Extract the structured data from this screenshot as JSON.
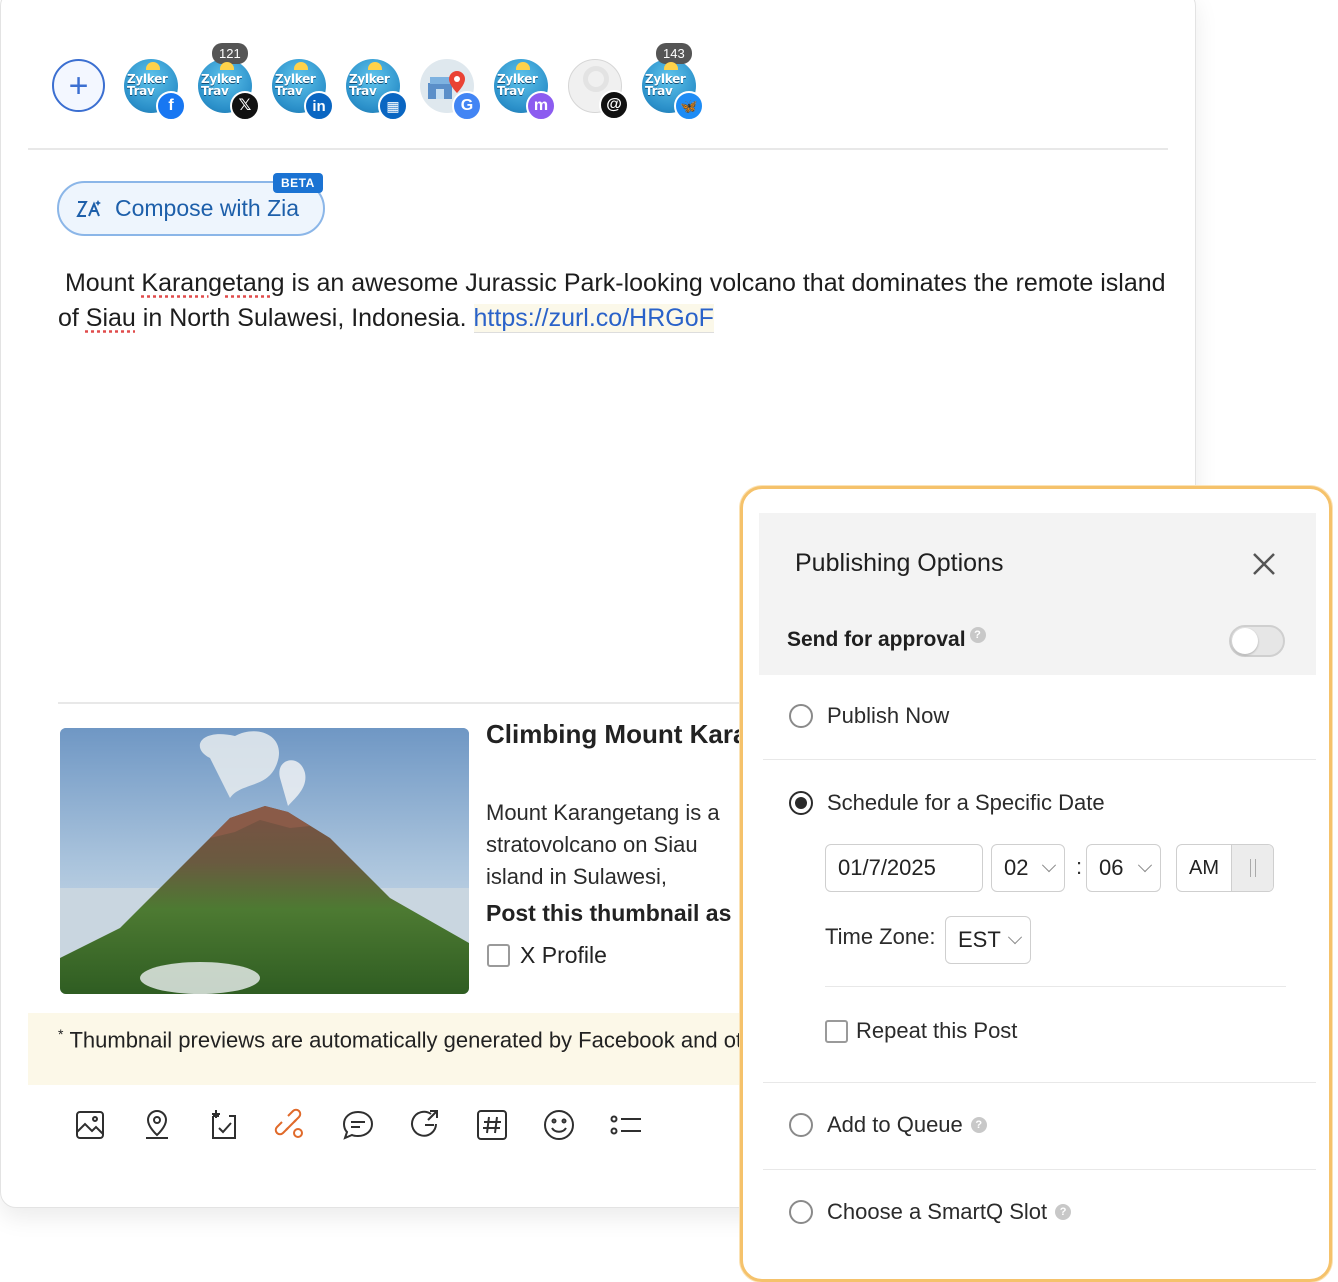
{
  "profiles": {
    "add_label": "+",
    "avatar_text": "Zylker Trav",
    "accounts": [
      {
        "network": "facebook",
        "badge": "",
        "color": "#1877f2",
        "glyph": "f"
      },
      {
        "network": "x",
        "badge": "121",
        "color": "#111111",
        "glyph": "𝕏"
      },
      {
        "network": "linkedin",
        "badge": "",
        "color": "#0a66c2",
        "glyph": "in"
      },
      {
        "network": "linkedin-page",
        "badge": "",
        "color": "#0a66c2",
        "glyph": "▦"
      },
      {
        "network": "google-business",
        "badge": "",
        "color": "#4285f4",
        "glyph": "G"
      },
      {
        "network": "mastodon",
        "badge": "",
        "color": "#8c5cf0",
        "glyph": "m"
      },
      {
        "network": "threads",
        "badge": "",
        "color": "#111111",
        "glyph": "@"
      },
      {
        "network": "bluesky",
        "badge": "143",
        "color": "#1e8cf5",
        "glyph": "🦋"
      }
    ]
  },
  "zia": {
    "label": "Compose with Zia",
    "badge": "BETA"
  },
  "post": {
    "text_1": "Mount ",
    "text_2": "Karangetang",
    "text_3": " is an awesome Jurassic Park-looking volcano that dominates the remote island of ",
    "text_4": "Siau",
    "text_5": " in North Sulawesi, Indonesia.  ",
    "link": "https://zurl.co/HRGoF"
  },
  "preview": {
    "title": "Climbing Mount Karangetang in Sulawesi",
    "description": "Mount Karangetang is a stratovolcano on Siau island in Sulawesi, Indonesia. Climb the mountain!",
    "post_thumbnail_label": "Post this thumbnail as image",
    "x_profile_label": "X Profile"
  },
  "note": {
    "marker": "*",
    "text": "Thumbnail previews are automatically generated by Facebook and other networks"
  },
  "toolbar": [
    "image-icon",
    "location-icon",
    "schedule-post-icon",
    "link-settings-icon",
    "comment-icon",
    "repost-icon",
    "hashtag-icon",
    "emoji-icon",
    "list-icon"
  ],
  "publishing": {
    "title": "Publishing Options",
    "approval_label": "Send for approval",
    "help": "?",
    "approval_enabled": false,
    "options": {
      "publish_now": "Publish Now",
      "schedule": "Schedule for a Specific Date",
      "add_to_queue": "Add to Queue",
      "smartq": "Choose a SmartQ Slot"
    },
    "selected": "schedule",
    "date": "01/7/2025",
    "hour": "02",
    "colon": ":",
    "minute": "06",
    "am": "AM",
    "timezone_label": "Time Zone:",
    "timezone": "EST",
    "repeat_label": "Repeat this Post"
  }
}
